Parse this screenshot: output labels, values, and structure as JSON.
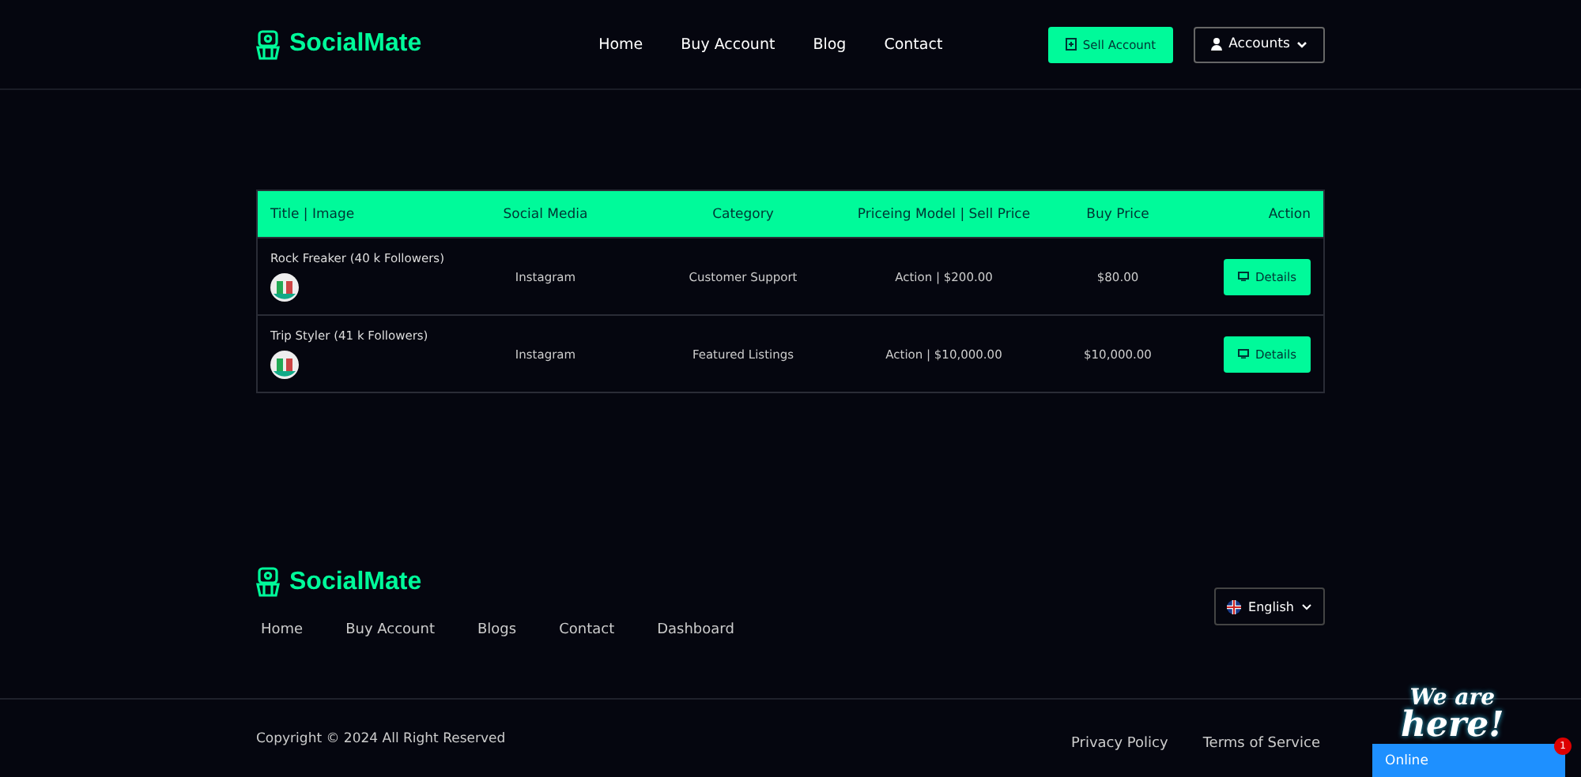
{
  "header": {
    "logo": "SocialMate",
    "nav": [
      "Home",
      "Buy Account",
      "Blog",
      "Contact"
    ],
    "sell_button": "Sell Account",
    "accounts_menu": "Accounts"
  },
  "table": {
    "columns": [
      "Title | Image",
      "Social Media",
      "Category",
      "Priceing Model | Sell Price",
      "Buy Price",
      "Action"
    ],
    "rows": [
      {
        "title": "Rock Freaker (40 k Followers)",
        "social_media": "Instagram",
        "category": "Customer Support",
        "pricing": "Action | $200.00",
        "buy_price": "$80.00",
        "action": "Details"
      },
      {
        "title": "Trip Styler (41 k Followers)",
        "social_media": "Instagram",
        "category": "Featured Listings",
        "pricing": "Action | $10,000.00",
        "buy_price": "$10,000.00",
        "action": "Details"
      }
    ]
  },
  "footer": {
    "logo": "SocialMate",
    "links": [
      "Home",
      "Buy Account",
      "Blogs",
      "Contact",
      "Dashboard"
    ],
    "language": "English",
    "copyright": "Copyright © 2024 All Right Reserved",
    "legal_links": [
      "Privacy Policy",
      "Terms of Service"
    ]
  },
  "chat_widget": {
    "tagline_top": "We are",
    "tagline_bottom": "here!",
    "status": "Online",
    "badge": "1"
  }
}
